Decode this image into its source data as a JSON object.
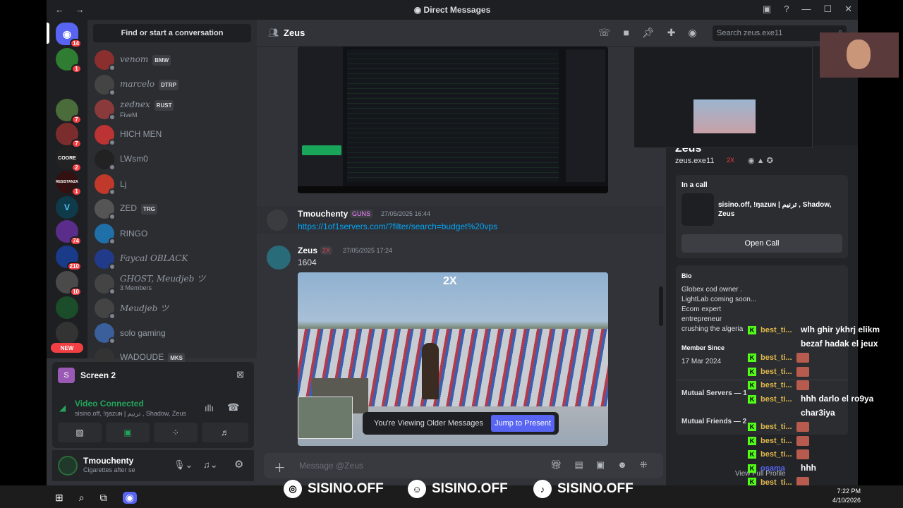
{
  "window": {
    "title": "Direct Messages",
    "nav": "← →"
  },
  "search": {
    "find_label": "Find or start a conversation",
    "channel_search": "Search zeus.exe11"
  },
  "guilds": [
    {
      "badge": "14"
    },
    {
      "badge": "1"
    },
    {
      "badge": "7"
    },
    {
      "badge": "7"
    },
    {
      "label": "COORE",
      "badge": "2"
    },
    {
      "label": "RESISTANZA",
      "badge": "1"
    },
    {
      "badge": ""
    },
    {
      "badge": "74"
    },
    {
      "badge": "210"
    },
    {
      "badge": "10"
    },
    {
      "badge": ""
    },
    {
      "badge": ""
    },
    {
      "label": "NEW"
    }
  ],
  "dms": [
    {
      "name": "venom",
      "tag": "BMW",
      "sub": ""
    },
    {
      "name": "marcelo",
      "tag": "DTRP",
      "sub": ""
    },
    {
      "name": "zednex",
      "tag": "RUST",
      "sub": "FiveM"
    },
    {
      "name": "HICH MEN",
      "tag": "",
      "sub": ""
    },
    {
      "name": "LWsm0",
      "tag": "",
      "sub": ""
    },
    {
      "name": "Lj",
      "tag": "",
      "sub": ""
    },
    {
      "name": "ZED",
      "tag": "TRG",
      "sub": ""
    },
    {
      "name": "RINGO",
      "tag": "",
      "sub": ""
    },
    {
      "name": "Faycal OBLACK",
      "tag": "",
      "sub": ""
    },
    {
      "name": "GHOST, Meudjeb ツ",
      "tag": "",
      "sub": "3 Members"
    },
    {
      "name": "Meudjeb ツ",
      "tag": "",
      "sub": ""
    },
    {
      "name": "solo gaming",
      "tag": "",
      "sub": ""
    },
    {
      "name": "WADOUDE",
      "tag": "MKS",
      "sub": ""
    }
  ],
  "voice": {
    "screen_title": "Screen 2",
    "status": "Video Connected",
    "participants": "sisino.off, !ŋazuɴ | ترنيم , Shadow, Zeus"
  },
  "user": {
    "name": "Tmouchenty",
    "status": "Cigarettes after se"
  },
  "header": {
    "channel": "Zeus"
  },
  "messages": [
    {
      "author": "Tmouchenty",
      "badge": "GUNS",
      "time": "27/05/2025 16:44",
      "link": "https://1of1servers.com/?filter/search=budget%20vps"
    },
    {
      "author": "Zeus",
      "badge": "2X",
      "time": "27/05/2025 17:24",
      "text": "1604"
    }
  ],
  "game_image": {
    "overlay": "2X"
  },
  "older": {
    "notice": "You're Viewing Older Messages",
    "jump": "Jump to Present"
  },
  "composer": {
    "placeholder": "Message @Zeus"
  },
  "profile": {
    "username": "zeus.exe11",
    "short": "Zeus",
    "badge": "2X",
    "in_call_label": "In a call",
    "in_call_members": "sisino.off, !ŋazuɴ | ترنيم , Shadow, Zeus",
    "open_call": "Open Call",
    "bio_label": "Bio",
    "bio_lines": [
      "Globex cod owner .",
      "LightLab coming soon...",
      "Ecom expert",
      "entrepreneur",
      "crushing the algeria"
    ],
    "member_since_label": "Member Since",
    "member_since": "17 Mar 2024",
    "mutual_servers": "Mutual Servers — 1",
    "mutual_friends": "Mutual Friends — 2",
    "view_full": "View Full Profile"
  },
  "stream_chat": [
    {
      "user": "best_ti...",
      "msg": "wlh ghir ykhrj elikm"
    },
    {
      "user": "",
      "msg": "bezaf hadak el jeux"
    },
    {
      "user": "best_ti...",
      "msg": ""
    },
    {
      "user": "best_ti...",
      "msg": ""
    },
    {
      "user": "best_ti...",
      "msg": ""
    },
    {
      "user": "best_ti...",
      "msg": "hhh darlo el ro9ya"
    },
    {
      "user": "",
      "msg": "char3iya"
    },
    {
      "user": "best_ti...",
      "msg": ""
    },
    {
      "user": "best_ti...",
      "msg": ""
    },
    {
      "user": "best_ti...",
      "msg": ""
    },
    {
      "user": "osama",
      "msg": "hhh"
    },
    {
      "user": "best_ti...",
      "msg": ""
    },
    {
      "user": "best_ti...",
      "msg": ""
    }
  ],
  "socials": [
    {
      "icon": "instagram-icon",
      "handle": "SISINO.OFF"
    },
    {
      "icon": "snapchat-icon",
      "handle": "SISINO.OFF"
    },
    {
      "icon": "tiktok-icon",
      "handle": "SISINO.OFF"
    }
  ],
  "taskbar": {
    "time": "7:22 PM",
    "date": "4/10/2026"
  }
}
